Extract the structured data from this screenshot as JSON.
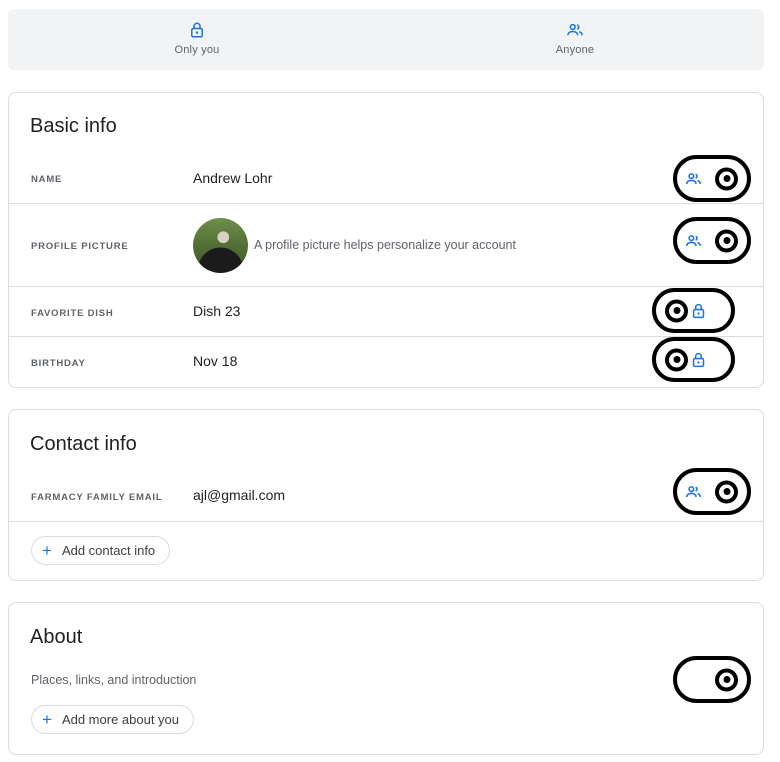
{
  "legend": {
    "items": [
      {
        "label": "Only you",
        "icon": "lock-icon"
      },
      {
        "label": "Anyone",
        "icon": "people-icon"
      }
    ]
  },
  "basic_info": {
    "title": "Basic info",
    "rows": [
      {
        "label": "NAME",
        "value": "Andrew Lohr",
        "visibility": "Anyone"
      },
      {
        "label": "PROFILE PICTURE",
        "note": "A profile picture helps personalize your account",
        "visibility": "Anyone"
      },
      {
        "label": "FAVORITE DISH",
        "value": "Dish 23",
        "visibility": "Only you"
      },
      {
        "label": "BIRTHDAY",
        "value": "Nov 18",
        "visibility": "Only you"
      }
    ]
  },
  "contact_info": {
    "title": "Contact info",
    "rows": [
      {
        "label": "FARMACY FAMILY EMAIL",
        "value": "ajl@gmail.com",
        "visibility": "Anyone"
      }
    ],
    "add_label": "Add contact info"
  },
  "about": {
    "title": "About",
    "description": "Places, links, and introduction",
    "add_label": "Add more about you"
  },
  "colors": {
    "accent": "#1a73e8",
    "border": "#dadce0",
    "legend_bg": "#f1f3f4",
    "muted_text": "#5f6368"
  }
}
